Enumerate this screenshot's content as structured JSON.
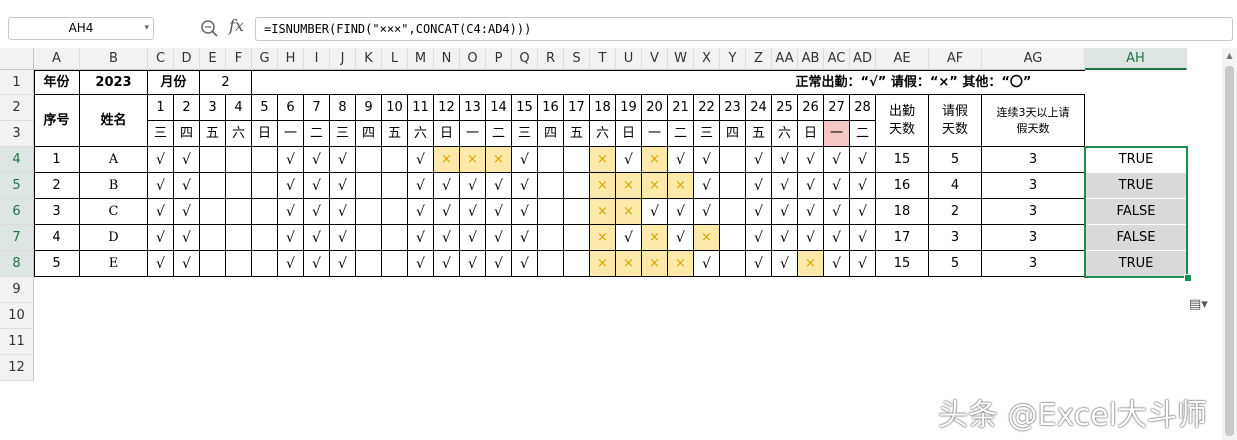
{
  "formula_bar": {
    "name_box": "AH4",
    "fx_label": "fx",
    "formula": "=ISNUMBER(FIND(\"×××\",CONCAT(C4:AD4)))"
  },
  "columns": [
    "A",
    "B",
    "C",
    "D",
    "E",
    "F",
    "G",
    "H",
    "I",
    "J",
    "K",
    "L",
    "M",
    "N",
    "O",
    "P",
    "Q",
    "R",
    "S",
    "T",
    "U",
    "V",
    "W",
    "X",
    "Y",
    "Z",
    "AA",
    "AB",
    "AC",
    "AD",
    "AE",
    "AF",
    "AG",
    "AH"
  ],
  "selected_column": "AH",
  "rows": [
    "1",
    "2",
    "3",
    "4",
    "5",
    "6",
    "7",
    "8",
    "9",
    "10",
    "11",
    "12"
  ],
  "selected_rows": [
    "4",
    "5",
    "6",
    "7",
    "8"
  ],
  "header": {
    "year_label": "年份",
    "year": "2023",
    "month_label": "月份",
    "month": "2",
    "legend": "正常出勤：“√”  请假：“×”  其他：“〇”",
    "seq_label": "序号",
    "name_label": "姓名",
    "attendance_days": "出勤天数",
    "leave_days": "请假天数",
    "consecutive_leave": "连续3天以上请假天数"
  },
  "days": [
    "1",
    "2",
    "3",
    "4",
    "5",
    "6",
    "7",
    "8",
    "9",
    "10",
    "11",
    "12",
    "13",
    "14",
    "15",
    "16",
    "17",
    "18",
    "19",
    "20",
    "21",
    "22",
    "23",
    "24",
    "25",
    "26",
    "27",
    "28"
  ],
  "weekdays": [
    "三",
    "四",
    "五",
    "六",
    "日",
    "一",
    "二",
    "三",
    "四",
    "五",
    "六",
    "日",
    "一",
    "二",
    "三",
    "四",
    "五",
    "六",
    "日",
    "一",
    "二",
    "三",
    "四",
    "五",
    "六",
    "日",
    "一",
    "二"
  ],
  "records": [
    {
      "seq": "1",
      "name": "A",
      "marks": [
        "√",
        "√",
        "",
        "",
        "",
        "√",
        "√",
        "√",
        "",
        "",
        "√",
        "×",
        "×",
        "×",
        "√",
        "",
        "",
        "×",
        "√",
        "×",
        "√",
        "√",
        "",
        "√",
        "√",
        "√",
        "√",
        "√"
      ],
      "attendance": "15",
      "leave": "5",
      "consecutive": "3",
      "result": "TRUE"
    },
    {
      "seq": "2",
      "name": "B",
      "marks": [
        "√",
        "√",
        "",
        "",
        "",
        "√",
        "√",
        "√",
        "",
        "",
        "√",
        "√",
        "√",
        "√",
        "√",
        "",
        "",
        "×",
        "×",
        "×",
        "×",
        "√",
        "",
        "√",
        "√",
        "√",
        "√",
        "√"
      ],
      "attendance": "16",
      "leave": "4",
      "consecutive": "3",
      "result": "TRUE"
    },
    {
      "seq": "3",
      "name": "C",
      "marks": [
        "√",
        "√",
        "",
        "",
        "",
        "√",
        "√",
        "√",
        "",
        "",
        "√",
        "√",
        "√",
        "√",
        "√",
        "",
        "",
        "×",
        "×",
        "√",
        "√",
        "√",
        "",
        "√",
        "√",
        "√",
        "√",
        "√"
      ],
      "attendance": "18",
      "leave": "2",
      "consecutive": "3",
      "result": "FALSE"
    },
    {
      "seq": "4",
      "name": "D",
      "marks": [
        "√",
        "√",
        "",
        "",
        "",
        "√",
        "√",
        "√",
        "",
        "",
        "√",
        "√",
        "√",
        "√",
        "√",
        "",
        "",
        "×",
        "√",
        "×",
        "√",
        "×",
        "",
        "√",
        "√",
        "√",
        "√",
        "√"
      ],
      "attendance": "17",
      "leave": "3",
      "consecutive": "3",
      "result": "FALSE"
    },
    {
      "seq": "5",
      "name": "E",
      "marks": [
        "√",
        "√",
        "",
        "",
        "",
        "√",
        "√",
        "√",
        "",
        "",
        "√",
        "√",
        "√",
        "√",
        "√",
        "",
        "",
        "×",
        "×",
        "×",
        "×",
        "√",
        "",
        "√",
        "√",
        "×",
        "√",
        "√"
      ],
      "attendance": "15",
      "leave": "5",
      "consecutive": "3",
      "result": "TRUE"
    }
  ],
  "colors": {
    "leave_fill": "#fde9a9",
    "holiday_fill": "#f4c6c6",
    "selection": "#1a8f52",
    "result_fill": "#d9d9d9"
  },
  "watermark": "头条 @Excel大斗师",
  "icons": {
    "zoom": "zoom-icon",
    "paste_options": "paste-options-icon"
  }
}
